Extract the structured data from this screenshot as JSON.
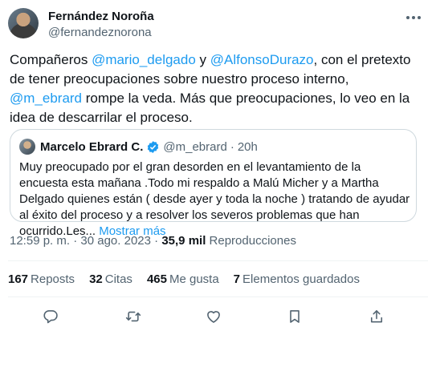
{
  "author": {
    "name": "Fernández Noroña",
    "handle": "@fernandeznorona"
  },
  "tweet": {
    "part1": "Compañeros ",
    "mention1": "@mario_delgado",
    "part2": " y ",
    "mention2": "@AlfonsoDurazo",
    "part3": ", con el pretexto de tener preocupaciones sobre nuestro proceso interno, ",
    "mention3": "@m_ebrard",
    "part4": " rompe la veda. Más que preocupaciones, lo veo en la idea de descarrilar el proceso."
  },
  "quote": {
    "name": "Marcelo Ebrard C.",
    "handle": "@m_ebrard",
    "dot": "·",
    "time": "20h",
    "text": "Muy preocupado por el gran desorden en el levantamiento de la encuesta  esta mañana .Todo mi respaldo a Malú Micher y a Martha Delgado quienes están ( desde ayer y toda la noche ) tratando de ayudar al éxito del proceso y a resolver los severos problemas que han ocurrido.Les... ",
    "show_more": "Mostrar más"
  },
  "meta": {
    "time": "12:59 p. m.",
    "sep1": " · ",
    "date": "30 ago. 2023",
    "sep2": " · ",
    "views_count": "35,9 mil",
    "views_label": " Reproducciones"
  },
  "stats": [
    {
      "count": "167",
      "label": "Reposts"
    },
    {
      "count": "32",
      "label": "Citas"
    },
    {
      "count": "465",
      "label": "Me gusta"
    },
    {
      "count": "7",
      "label": "Elementos guardados"
    }
  ],
  "colors": {
    "accent": "#1d9bf0",
    "text": "#0f1419",
    "secondary": "#536471",
    "border": "#cfd9de"
  },
  "icons": [
    "more-icon",
    "verified-badge-icon",
    "reply-icon",
    "repost-icon",
    "like-icon",
    "bookmark-icon",
    "share-icon"
  ]
}
